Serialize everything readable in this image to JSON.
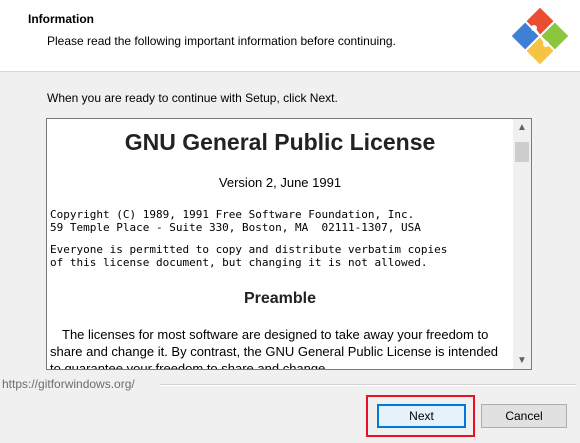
{
  "header": {
    "title": "Information",
    "subtitle": "Please read the following important information before continuing."
  },
  "main": {
    "ready_text": "When you are ready to continue with Setup, click Next."
  },
  "license": {
    "title": "GNU General Public License",
    "version": "Version 2, June 1991",
    "copyright_line1": "Copyright (C) 1989, 1991 Free Software Foundation, Inc.",
    "copyright_line2": "59 Temple Place - Suite 330, Boston, MA  02111-1307, USA",
    "permission_line1": "Everyone is permitted to copy and distribute verbatim copies",
    "permission_line2": "of this license document, but changing it is not allowed.",
    "preamble_heading": "Preamble",
    "preamble_text": "The licenses for most software are designed to take away your freedom to share and change it. By contrast, the GNU General Public License is intended to guarantee your freedom to share and change"
  },
  "footer": {
    "url": "https://gitforwindows.org/",
    "next_label": "Next",
    "cancel_label": "Cancel"
  },
  "colors": {
    "accent": "#0078d7",
    "highlight": "#e81123"
  },
  "icons": {
    "logo": "git-logo-icon",
    "scroll_up": "chevron-up-icon",
    "scroll_down": "chevron-down-icon"
  }
}
